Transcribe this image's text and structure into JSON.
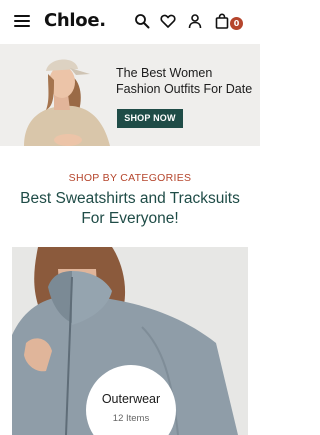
{
  "header": {
    "logo": "Chloe.",
    "cart_count": "0",
    "icons": [
      "menu-icon",
      "search-icon",
      "heart-icon",
      "user-icon",
      "shopping-bag-icon"
    ]
  },
  "banner": {
    "title": "The Best Women Fashion Outfits For Date",
    "cta_label": "SHOP NOW"
  },
  "categories": {
    "kicker": "SHOP BY CATEGORIES",
    "title": "Best Sweatshirts and Tracksuits For Everyone!",
    "items": [
      {
        "name": "Outerwear",
        "count": "12 Items"
      }
    ]
  },
  "colors": {
    "accent": "#b5452c",
    "brand_green": "#1f4c47",
    "banner_bg": "#efeeec"
  }
}
